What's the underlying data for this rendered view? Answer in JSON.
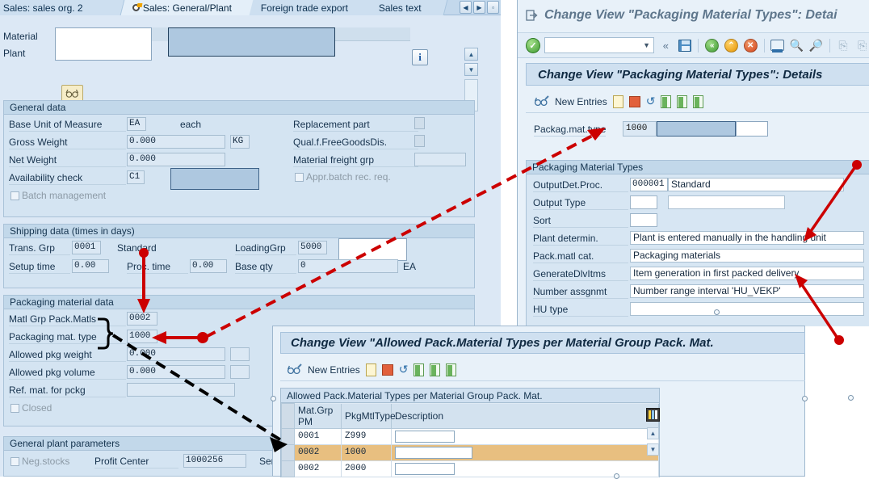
{
  "left_window": {
    "tabs": [
      {
        "label": "Sales: sales org. 2",
        "active": false
      },
      {
        "label": "Sales: General/Plant",
        "active": true
      },
      {
        "label": "Foreign trade export",
        "active": false
      },
      {
        "label": "Sales text",
        "active": false
      }
    ],
    "header": {
      "material_label": "Material",
      "material_value": "",
      "plant_label": "Plant",
      "plant_value": "",
      "info_icon": "info-icon",
      "magnify_icon": "glasses-icon"
    },
    "general_data": {
      "title": "General data",
      "fields": [
        {
          "label": "Base Unit of Measure",
          "value": "EA",
          "suffix": "each"
        },
        {
          "label": "Gross Weight",
          "value": "0.000",
          "unit": "KG"
        },
        {
          "label": "Net Weight",
          "value": "0.000",
          "unit": ""
        },
        {
          "label": "Availability check",
          "value": "C1",
          "desc": ""
        }
      ],
      "batch_management": "Batch management",
      "right_fields": [
        {
          "label": "Replacement part",
          "value": ""
        },
        {
          "label": "Qual.f.FreeGoodsDis.",
          "value": ""
        },
        {
          "label": "Material freight grp",
          "value": ""
        }
      ],
      "appr_batch": "Appr.batch rec. req."
    },
    "shipping_data": {
      "title": "Shipping data (times in days)",
      "trans_grp_label": "Trans. Grp",
      "trans_grp_value": "0001",
      "trans_grp_desc": "Standard",
      "loading_grp_label": "LoadingGrp",
      "loading_grp_value": "5000",
      "loading_grp_desc": "",
      "setup_time_label": "Setup time",
      "setup_time_value": "0.00",
      "proc_time_label": "Proc. time",
      "proc_time_value": "0.00",
      "base_qty_label": "Base qty",
      "base_qty_value": "0",
      "base_qty_unit": "EA"
    },
    "packaging_material_data": {
      "title": "Packaging material data",
      "fields": [
        {
          "label": "Matl Grp Pack.Matls",
          "value": "0002"
        },
        {
          "label": "Packaging mat. type",
          "value": "1000"
        },
        {
          "label": "Allowed pkg weight",
          "value": "0.000"
        },
        {
          "label": "Allowed pkg volume",
          "value": "0.000"
        },
        {
          "label": "Ref. mat. for pckg",
          "value": ""
        }
      ],
      "closed_label": "Closed"
    },
    "general_plant_parameters": {
      "title": "General plant parameters",
      "neg_stocks_label": "Neg.stocks",
      "profit_center_label": "Profit Center",
      "profit_center_value": "1000256",
      "serial_label": "Seri"
    }
  },
  "right_window": {
    "title": "Change View \"Packaging Material Types\": Detai",
    "banner": "Change View \"Packaging Material Types\": Details",
    "command_field_value": "",
    "toolbar": {
      "ok_icon": "check-icon",
      "more_icon": "chevron-double-left-icon",
      "save_icon": "save-icon",
      "back_icon": "back-green-icon",
      "exit_icon": "exit-yellow-icon",
      "cancel_icon": "cancel-red-icon",
      "print_icon": "print-icon",
      "find_icon": "find-icon",
      "find_next_icon": "find-next-icon",
      "first_page_icon": "first-page-icon",
      "prev_page_icon": "prev-page-icon"
    },
    "toolbar2": {
      "display_change_icon": "glasses-pencil-icon",
      "new_entries_label": "New Entries",
      "copy_icon": "copy-icon",
      "delete_icon": "delete-icon",
      "undo_icon": "undo-icon",
      "prev_entry_icon": "prev-entry-icon",
      "next_entry_icon": "next-entry-icon",
      "other_entry_icon": "other-entry-icon"
    },
    "pack_mat_type": {
      "label": "Packag.mat.type",
      "value": "1000",
      "description": "",
      "description2": ""
    },
    "details_group": {
      "title": "Packaging Material Types",
      "rows": [
        {
          "label": "OutputDet.Proc.",
          "key": "000001",
          "value": "Standard"
        },
        {
          "label": "Output Type",
          "key": "",
          "value": ""
        },
        {
          "label": "Sort",
          "key": "",
          "value": null
        },
        {
          "label": "Plant determin.",
          "key": null,
          "value": "Plant is entered manually in the handling unit"
        },
        {
          "label": "Pack.matl cat.",
          "key": null,
          "value": "Packaging materials"
        },
        {
          "label": "GenerateDlvItms",
          "key": null,
          "value": "Item generation in first packed delivery"
        },
        {
          "label": "Number assgnmt",
          "key": null,
          "value": "Number range interval 'HU_VEKP'"
        },
        {
          "label": "HU type",
          "key": null,
          "value": ""
        }
      ]
    }
  },
  "bottom_window": {
    "banner": "Change View \"Allowed Pack.Material Types per Material Group Pack. Mat.",
    "toolbar": {
      "display_change_icon": "glasses-pencil-icon",
      "new_entries_label": "New Entries",
      "copy_icon": "copy-icon",
      "delete_icon": "delete-icon",
      "undo_icon": "undo-icon",
      "prev_entry_icon": "prev-entry-icon",
      "next_entry_icon": "next-entry-icon",
      "other_entry_icon": "other-entry-icon"
    },
    "table": {
      "title": "Allowed Pack.Material Types per Material Group Pack. Mat.",
      "columns": [
        "Mat.Grp PM",
        "PkgMtlType",
        "Description"
      ],
      "rows": [
        {
          "mat_grp_pm": "0001",
          "pkg_mtl_type": "Z999",
          "description": "",
          "selected": false
        },
        {
          "mat_grp_pm": "0002",
          "pkg_mtl_type": "1000",
          "description": "",
          "selected": true
        },
        {
          "mat_grp_pm": "0002",
          "pkg_mtl_type": "2000",
          "description": "",
          "selected": false
        }
      ],
      "config_icon": "column-config-icon",
      "scroll_up_icon": "scroll-up-icon",
      "scroll_down_icon": "scroll-down-icon"
    }
  },
  "annotations": {
    "accent_red": "#cc0000",
    "accent_black": "#000000",
    "highlight_row": "#e8bf80"
  }
}
